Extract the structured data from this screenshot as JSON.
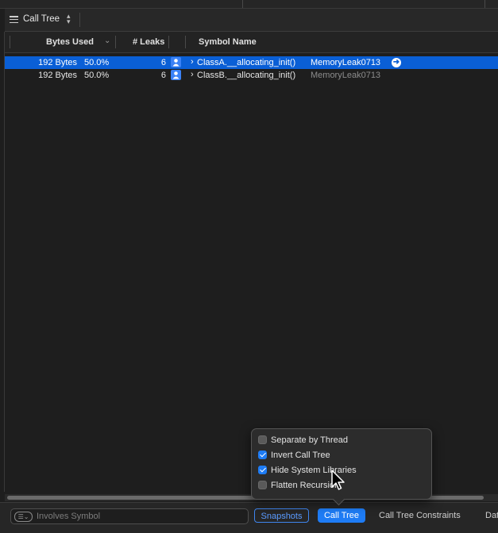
{
  "jumpbar": {
    "label": "Call Tree"
  },
  "columns": {
    "bytes_used": "Bytes Used",
    "leaks": "# Leaks",
    "symbol_name": "Symbol Name"
  },
  "rows": [
    {
      "bytes": "192 Bytes",
      "percent": "50.0%",
      "leaks": "6",
      "symbol": "ClassA.__allocating_init()",
      "library": "MemoryLeak0713",
      "selected": true
    },
    {
      "bytes": "192 Bytes",
      "percent": "50.0%",
      "leaks": "6",
      "symbol": "ClassB.__allocating_init()",
      "library": "MemoryLeak0713",
      "selected": false
    }
  ],
  "popover": {
    "options": [
      {
        "label": "Separate by Thread",
        "checked": false
      },
      {
        "label": "Invert Call Tree",
        "checked": true
      },
      {
        "label": "Hide System Libraries",
        "checked": true
      },
      {
        "label": "Flatten Recursion",
        "checked": false
      }
    ]
  },
  "bottom": {
    "filter_placeholder": "Involves Symbol",
    "snapshots_label": "Snapshots",
    "call_tree_label": "Call Tree",
    "constraints_label": "Call Tree Constraints",
    "data_label": "Dat"
  },
  "colors": {
    "selection": "#0a5fd6",
    "accent": "#1e7cf5"
  },
  "icons": [
    "menu-icon",
    "updown-arrows-icon",
    "sort-chevron-icon",
    "person-icon",
    "disclosure-chevron-icon",
    "go-arrow-icon",
    "filter-icon",
    "pointer-cursor-icon"
  ]
}
